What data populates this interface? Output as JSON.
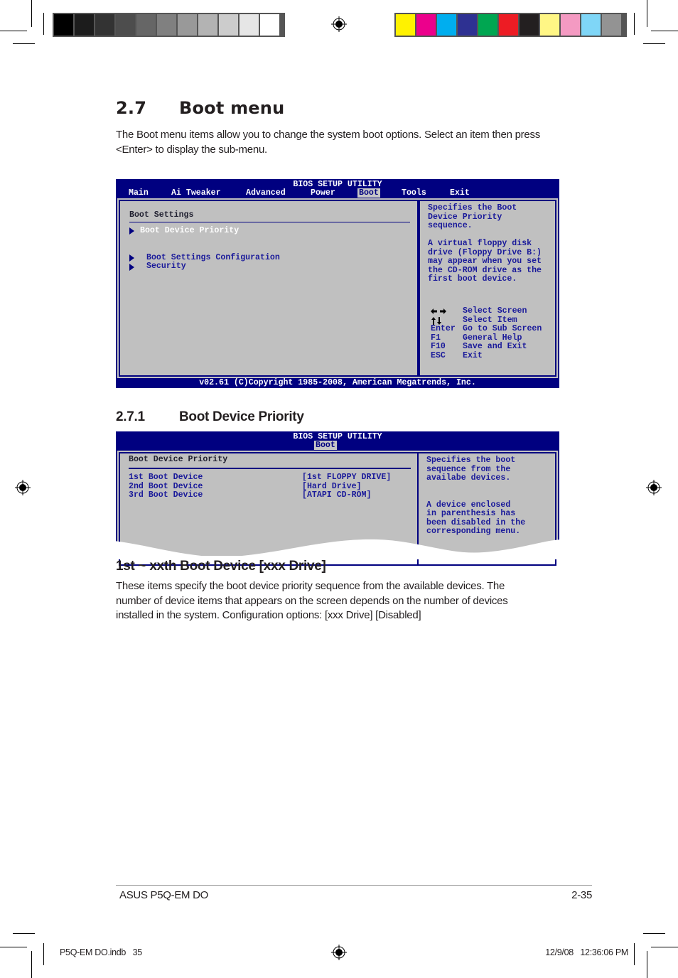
{
  "print_marks": {
    "grayscale_swatches": [
      "#000000",
      "#1c1c1c",
      "#333333",
      "#4d4d4d",
      "#666666",
      "#808080",
      "#999999",
      "#b3b3b3",
      "#cccccc",
      "#e6e6e6",
      "#ffffff"
    ],
    "color_swatches": [
      "#fff200",
      "#ec008c",
      "#00aeef",
      "#2e3192",
      "#00a651",
      "#ed1c24",
      "#231f20",
      "#fff685",
      "#f49ac2",
      "#7fd6f7",
      "#939393"
    ],
    "icon": "registration-mark-icon"
  },
  "section": {
    "number": "2.7",
    "title": "Boot menu",
    "intro": "The Boot menu items allow you to change the system boot options. Select an item then press <Enter> to display the sub-menu."
  },
  "bios_main": {
    "title": "BIOS SETUP UTILITY",
    "menu": [
      "Main",
      "Ai Tweaker",
      "Advanced",
      "Power",
      "Boot",
      "Tools",
      "Exit"
    ],
    "active_menu": "Boot",
    "group_heading": "Boot Settings",
    "items": [
      {
        "label": "Boot Device Priority",
        "selected": true,
        "icon": "submenu-arrow-icon"
      },
      {
        "label": "Boot Settings Configuration",
        "selected": false,
        "icon": "submenu-arrow-icon"
      },
      {
        "label": "Security",
        "selected": false,
        "icon": "submenu-arrow-icon"
      }
    ],
    "help": [
      "Specifies the Boot",
      "Device Priority",
      "sequence.",
      "",
      "A virtual floppy disk",
      "drive (Floppy Drive B:)",
      "may appear when you set",
      "the CD-ROM drive as the",
      "first boot device."
    ],
    "keys": [
      {
        "key": "←→",
        "icon": "left-right-arrows-icon",
        "action": "Select Screen"
      },
      {
        "key": "↑↓",
        "icon": "up-down-arrows-icon",
        "action": "Select Item"
      },
      {
        "key": "Enter",
        "action": "Go to Sub Screen"
      },
      {
        "key": "F1",
        "action": "General Help"
      },
      {
        "key": "F10",
        "action": "Save and Exit"
      },
      {
        "key": "ESC",
        "action": "Exit"
      }
    ],
    "footer": "v02.61 (C)Copyright 1985-2008, American Megatrends, Inc."
  },
  "subsection": {
    "number": "2.7.1",
    "title": "Boot Device Priority"
  },
  "bios_sub": {
    "title": "BIOS SETUP UTILITY",
    "active_menu": "Boot",
    "group_heading": "Boot Device Priority",
    "rows": [
      {
        "label": "1st Boot Device",
        "value": "[1st FLOPPY DRIVE]"
      },
      {
        "label": "2nd Boot Device",
        "value": "[Hard Drive]"
      },
      {
        "label": "3rd Boot Device",
        "value": "[ATAPI CD-ROM]"
      }
    ],
    "help": [
      "Specifies the boot",
      "sequence from the",
      "availabe devices.",
      "",
      "",
      "A device enclosed",
      "in parenthesis has",
      "been disabled in the",
      "corresponding menu."
    ]
  },
  "item_section": {
    "title": "1st ~ xxth Boot Device [xxx Drive]",
    "body": "These items specify the boot device priority sequence from the available devices. The number of device items that appears on the screen depends on the number of devices installed in the system. Configuration options: [xxx Drive] [Disabled]"
  },
  "page_footer": {
    "product": "ASUS P5Q-EM DO",
    "page": "2-35"
  },
  "slug": {
    "file": "P5Q-EM DO.indb   35",
    "timestamp": "12/9/08   12:36:06 PM"
  }
}
